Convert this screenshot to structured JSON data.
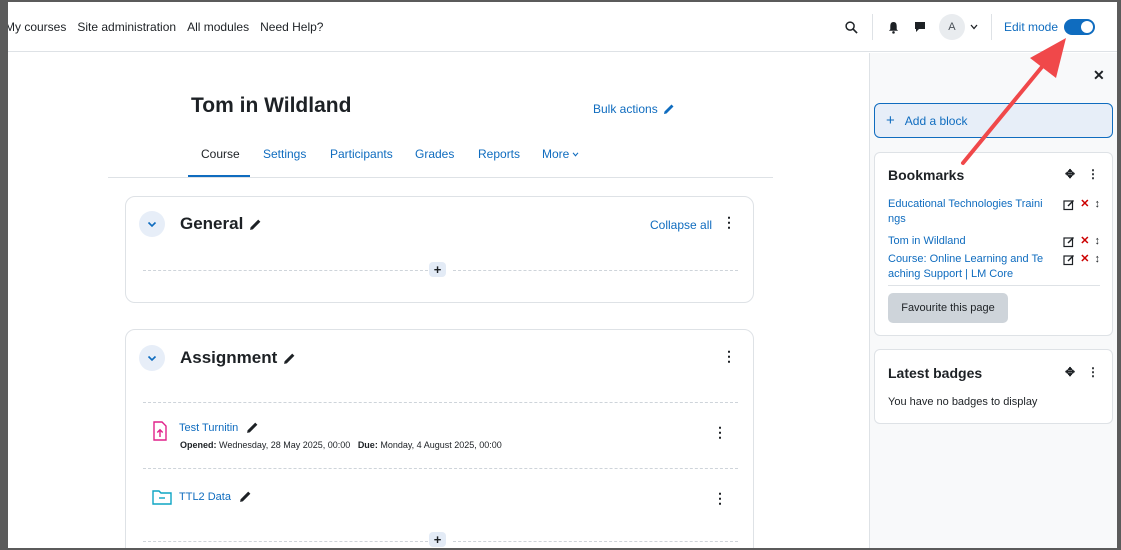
{
  "nav": {
    "links": [
      "My courses",
      "Site administration",
      "All modules",
      "Need Help?"
    ],
    "avatar_initial": "A",
    "edit_mode_label": "Edit mode",
    "edit_mode_on": true
  },
  "course": {
    "title": "Tom in Wildland",
    "bulk_actions": "Bulk actions",
    "tabs": [
      "Course",
      "Settings",
      "Participants",
      "Grades",
      "Reports",
      "More"
    ],
    "active_tab": "Course"
  },
  "sections": {
    "general": {
      "title": "General",
      "collapse_all": "Collapse all"
    },
    "assignment": {
      "title": "Assignment",
      "activities": [
        {
          "name": "Test Turnitin",
          "opened_label": "Opened:",
          "opened_value": "Wednesday, 28 May 2025, 00:00",
          "due_label": "Due:",
          "due_value": "Monday, 4 August 2025, 00:00"
        },
        {
          "name": "TTL2 Data"
        }
      ]
    }
  },
  "drawer": {
    "add_block": "Add a block",
    "bookmarks": {
      "title": "Bookmarks",
      "items": [
        {
          "line1": "Educational Technologies Traini",
          "line2": "ngs"
        },
        {
          "line1": "Tom in Wildland",
          "line2": ""
        },
        {
          "line1": "Course: Online Learning and Te",
          "line2": "aching Support | LM Core"
        }
      ],
      "favourite_button": "Favourite this page"
    },
    "badges": {
      "title": "Latest badges",
      "empty_text": "You have no badges to display"
    }
  },
  "colors": {
    "link": "#0f6cbf",
    "annotation_arrow": "#f0484a",
    "delete_icon": "#cc0000"
  },
  "icons": [
    "search-icon",
    "bell-icon",
    "chat-icon",
    "chevron-down-icon",
    "pencil-icon",
    "kebab-icon",
    "plus-icon",
    "close-icon",
    "move-icon",
    "upload-file-icon",
    "folder-icon",
    "edit-icon",
    "delete-icon",
    "reorder-icon"
  ]
}
